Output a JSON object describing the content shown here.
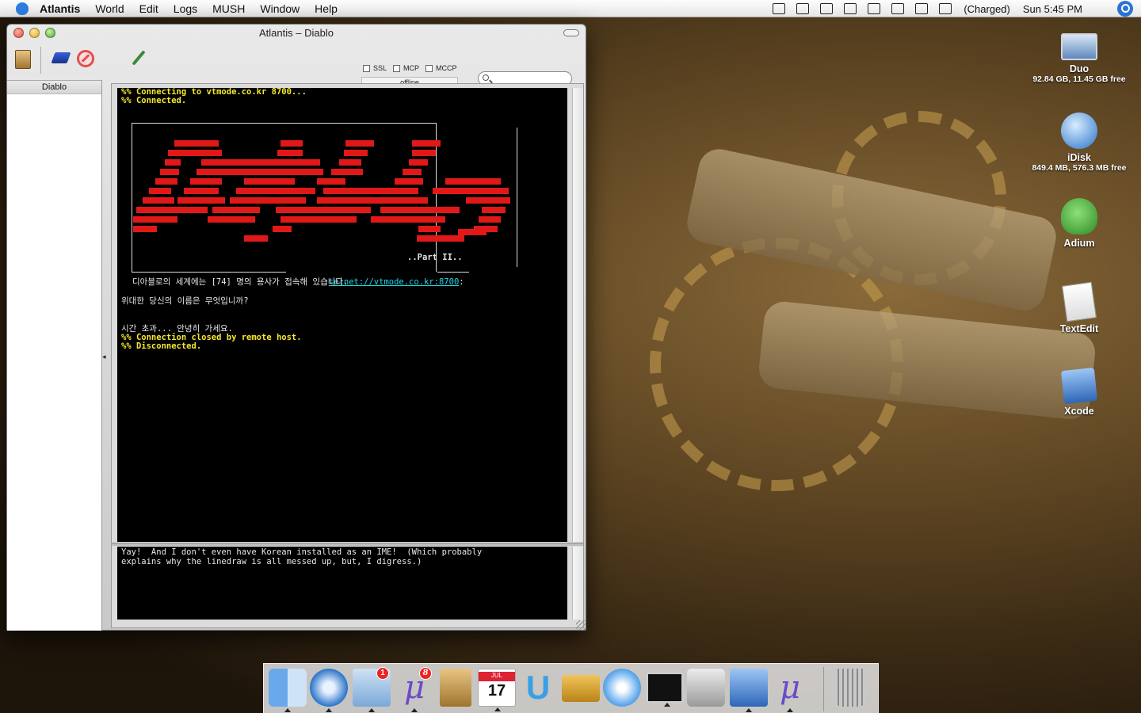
{
  "menubar": {
    "app_name": "Atlantis",
    "items": [
      "World",
      "Edit",
      "Logs",
      "MUSH",
      "Window",
      "Help"
    ],
    "battery_status": "(Charged)",
    "clock": "Sun 5:45 PM"
  },
  "window": {
    "title": "Atlantis – Diablo",
    "checkboxes": [
      "SSL",
      "MCP",
      "MCCP"
    ],
    "connection_status": "offline",
    "search_placeholder": "",
    "sidebar_world": "Diablo"
  },
  "terminal": {
    "connecting": "%% Connecting to vtmode.co.kr 8700...",
    "connected": "%% Connected.",
    "part_label": "..Part II..",
    "telnet_prefix": ":",
    "telnet_url": "telnet://vtmode.co.kr:8700",
    "telnet_suffix": ":",
    "users_line": "디아블로의 세계에는 [74] 명의 용사가 접속해 있습니다.",
    "name_prompt": "위대한 당신의 이름은 무엇입니까?",
    "timeout": "시간 초과... 안녕히 가세요.",
    "closed": "%% Connection closed by remote host.",
    "disconnected": "%% Disconnected."
  },
  "input": {
    "text_line1": "Yay!  And I don't even have Korean installed as an IME!  (Which probably",
    "text_line2": "explains why the linedraw is all messed up, but, I digress.)"
  },
  "desktop_icons": [
    {
      "name": "Duo",
      "sub": "92.84 GB, 11.45 GB free"
    },
    {
      "name": "iDisk",
      "sub": "849.4 MB, 576.3 MB free"
    },
    {
      "name": "Adium",
      "sub": ""
    },
    {
      "name": "TextEdit",
      "sub": ""
    },
    {
      "name": "Xcode",
      "sub": ""
    }
  ],
  "dock": {
    "mail_badge": "1",
    "mu_badge": "8",
    "calendar_month": "JUL",
    "calendar_day": "17"
  }
}
